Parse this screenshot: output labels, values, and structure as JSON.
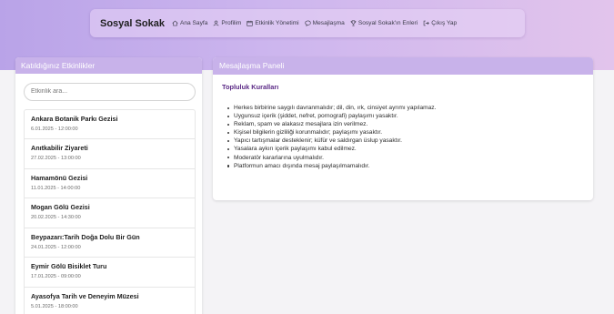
{
  "nav": {
    "brand": "Sosyal Sokak",
    "items": [
      {
        "label": "Ana Sayfa",
        "icon": "home-icon"
      },
      {
        "label": "Profilim",
        "icon": "user-icon"
      },
      {
        "label": "Etkinlik Yönetimi",
        "icon": "calendar-icon"
      },
      {
        "label": "Mesajlaşma",
        "icon": "chat-icon"
      },
      {
        "label": "Sosyal Sokak'ın Enleri",
        "icon": "trophy-icon"
      },
      {
        "label": "Çıkış Yap",
        "icon": "logout-icon"
      }
    ]
  },
  "events_panel": {
    "title": "Katıldığınız Etkinlikler",
    "search_placeholder": "Etkinlik ara...",
    "events": [
      {
        "title": "Ankara Botanik Parkı Gezisi",
        "date": "6.01.2025 - 12:00:00"
      },
      {
        "title": "Anıtkabilir Ziyareti",
        "date": "27.02.2025 - 13:00:00"
      },
      {
        "title": "Hamamönü Gezisi",
        "date": "11.01.2025 - 14:00:00"
      },
      {
        "title": "Mogan Gölü Gezisi",
        "date": "20.02.2025 - 14:30:00"
      },
      {
        "title": "Beypazarı:Tarih Doğa Dolu Bir Gün",
        "date": "24.01.2025 - 12:00:00"
      },
      {
        "title": "Eymir Gölü Bisiklet Turu",
        "date": "17.01.2025 - 09:00:00"
      },
      {
        "title": "Ayasofya Tarih ve Deneyim Müzesi",
        "date": "5.01.2025 - 18:00:00"
      }
    ]
  },
  "messaging_panel": {
    "title": "Mesajlaşma Paneli",
    "rules_title": "Topluluk Kuralları",
    "rules": [
      "Herkes birbirine saygılı davranmalıdır; dil, din, ırk, cinsiyet ayrımı yapılamaz.",
      "Uygunsuz içerik (şiddet, nefret, pornografi) paylaşımı yasaktır.",
      "Reklam, spam ve alakasız mesajlara izin verilmez.",
      "Kişisel bilgilerin gizliliği korunmalıdır; paylaşımı yasaktır.",
      "Yapıcı tartışmalar desteklenir; küfür ve saldırgan üslup yasaktır.",
      "Yasalara aykırı içerik paylaşımı kabul edilmez.",
      "Moderatör kararlarına uyulmalıdır.",
      "Platformun amacı dışında mesaj paylaşılmamalıdır."
    ]
  },
  "colors": {
    "header_gradient_start": "#b9a3e8",
    "header_gradient_end": "#e2c4ec",
    "panel_header": "#c8b2ea",
    "rules_title": "#5b2a86"
  }
}
